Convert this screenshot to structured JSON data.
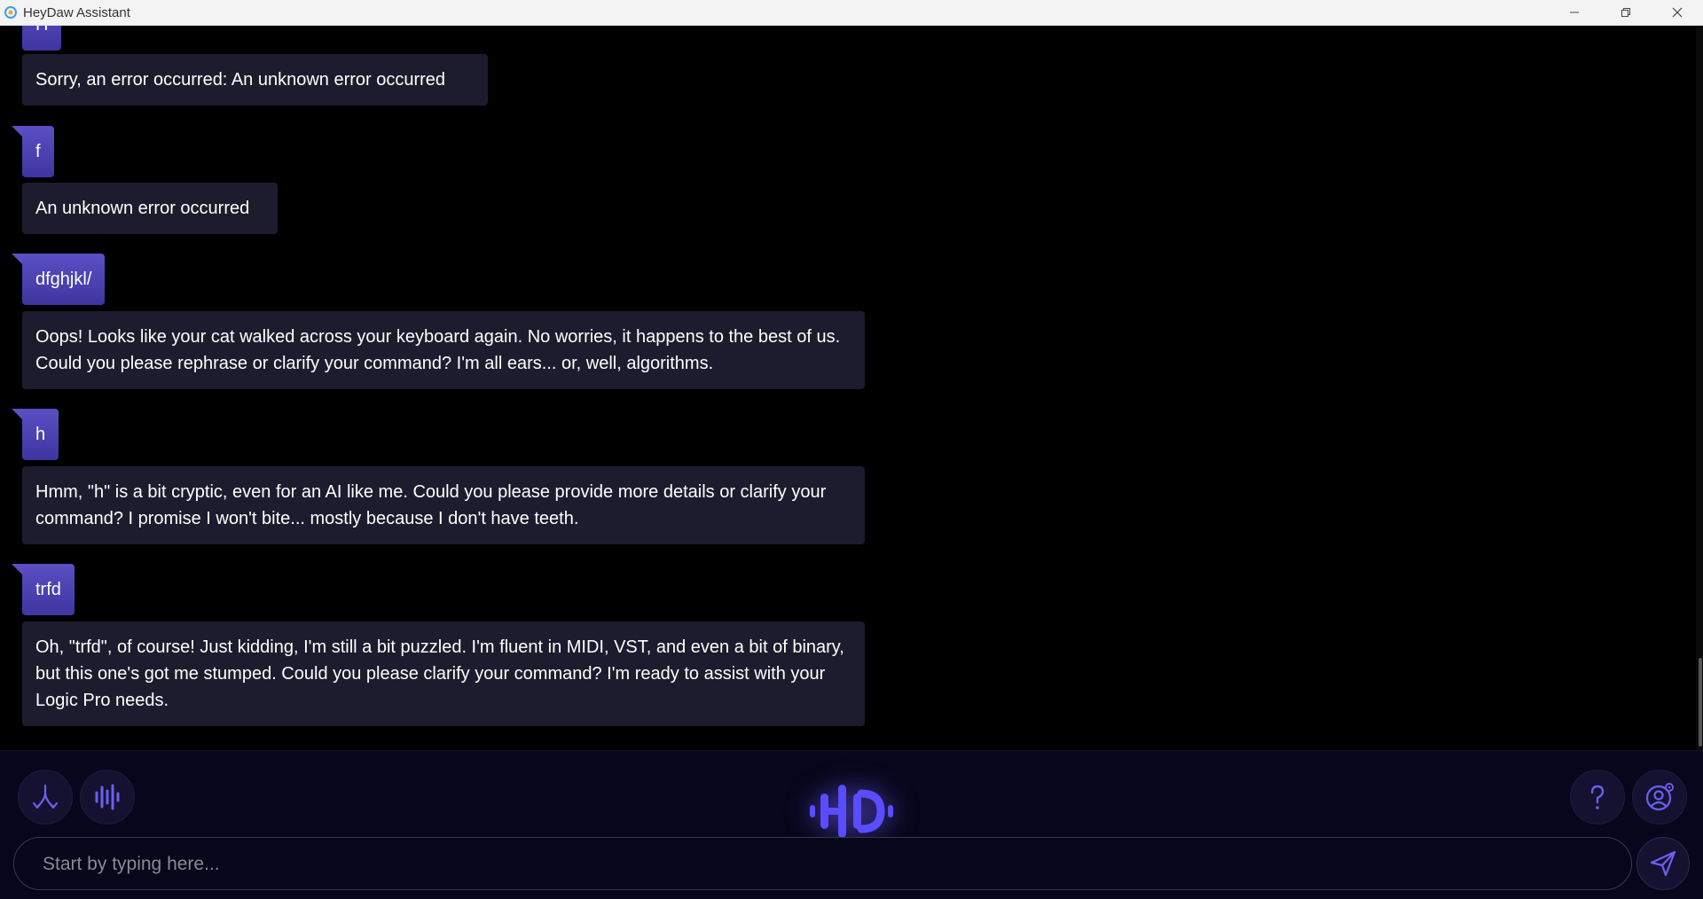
{
  "window": {
    "title": "HeyDaw Assistant",
    "controls": [
      "minimize",
      "restore",
      "close"
    ]
  },
  "messages": [
    {
      "role": "user",
      "text": "H"
    },
    {
      "role": "assistant",
      "text": "Sorry, an error occurred: An unknown error occurred"
    },
    {
      "role": "user",
      "text": "f"
    },
    {
      "role": "assistant",
      "text": "An unknown error occurred"
    },
    {
      "role": "user",
      "text": "dfghjkl/"
    },
    {
      "role": "assistant",
      "text": "Oops! Looks like your cat walked across your keyboard again. No worries, it happens to the best of us. Could you please rephrase or clarify your command? I'm all ears... or, well, algorithms."
    },
    {
      "role": "user",
      "text": "h"
    },
    {
      "role": "assistant",
      "text": "Hmm, \"h\" is a bit cryptic, even for an AI like me. Could you please provide more details or clarify your command? I promise I won't bite... mostly because I don't have teeth."
    },
    {
      "role": "user",
      "text": "trfd"
    },
    {
      "role": "assistant",
      "text": "Oh, \"trfd\", of course! Just kidding, I'm still a bit puzzled. I'm fluent in MIDI, VST, and even a bit of binary, but this one's got me stumped. Could you please clarify your command? I'm ready to assist with your Logic Pro needs."
    }
  ],
  "toolbar": {
    "left_icons": [
      "merge-arrows-icon",
      "waveform-icon"
    ],
    "center_logo": "heydaw-logo-icon",
    "right_icons": [
      "help-icon",
      "user-settings-icon"
    ]
  },
  "composer": {
    "placeholder": "Start by typing here...",
    "value": "",
    "send_icon": "send-icon"
  },
  "colors": {
    "background": "#000000",
    "user_bubble": "#4a40b4",
    "assistant_bubble": "#1d1c2e",
    "accent": "#6a5cff",
    "bottom_bar": "#07061a"
  }
}
